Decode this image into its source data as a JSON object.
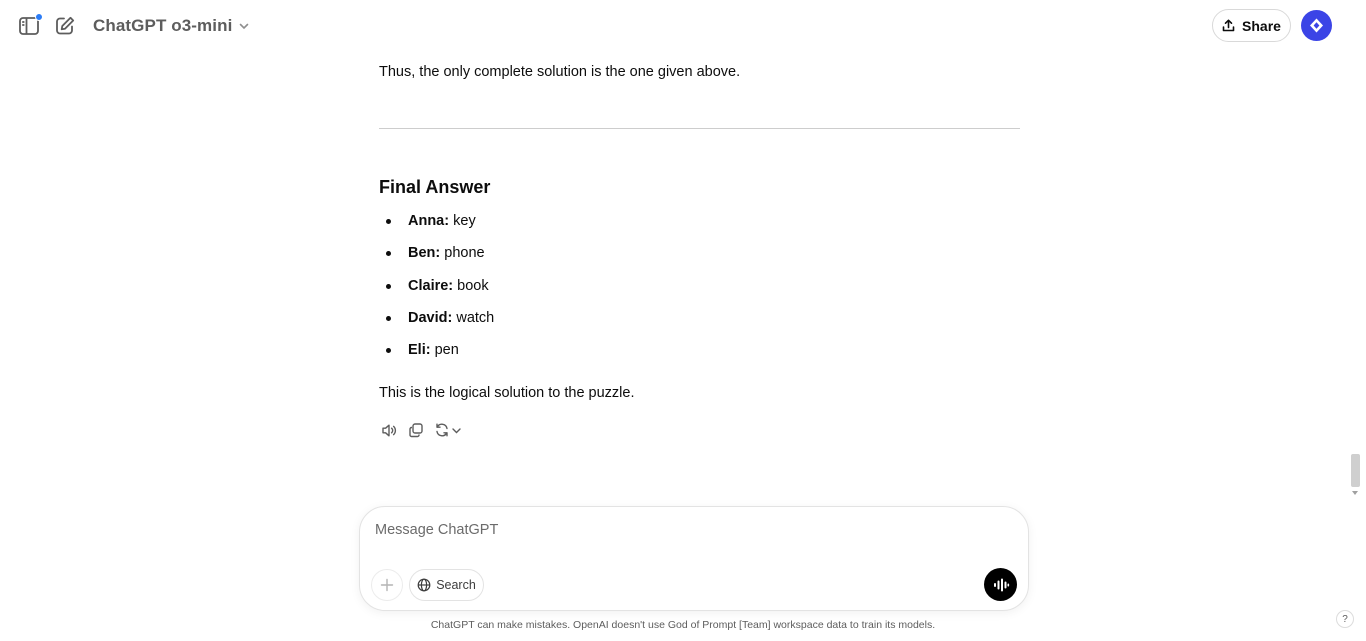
{
  "header": {
    "model_name": "ChatGPT o3-mini",
    "share_label": "Share",
    "sidebar_icon": "sidebar-toggle-icon",
    "new_chat_icon": "edit-icon"
  },
  "conversation": {
    "intro": "Thus, the only complete solution is the one given above.",
    "heading": "Final Answer",
    "answers": [
      {
        "name": "Anna:",
        "item": "key"
      },
      {
        "name": "Ben:",
        "item": "phone"
      },
      {
        "name": "Claire:",
        "item": "book"
      },
      {
        "name": "David:",
        "item": "watch"
      },
      {
        "name": "Eli:",
        "item": "pen"
      }
    ],
    "closing": "This is the logical solution to the puzzle."
  },
  "composer": {
    "placeholder": "Message ChatGPT",
    "search_label": "Search"
  },
  "footer": {
    "disclaimer": "ChatGPT can make mistakes. OpenAI doesn't use God of Prompt [Team] workspace data to train its models.",
    "help_label": "?"
  },
  "colors": {
    "accent": "#3b44e6",
    "notify": "#2b7cf6"
  }
}
